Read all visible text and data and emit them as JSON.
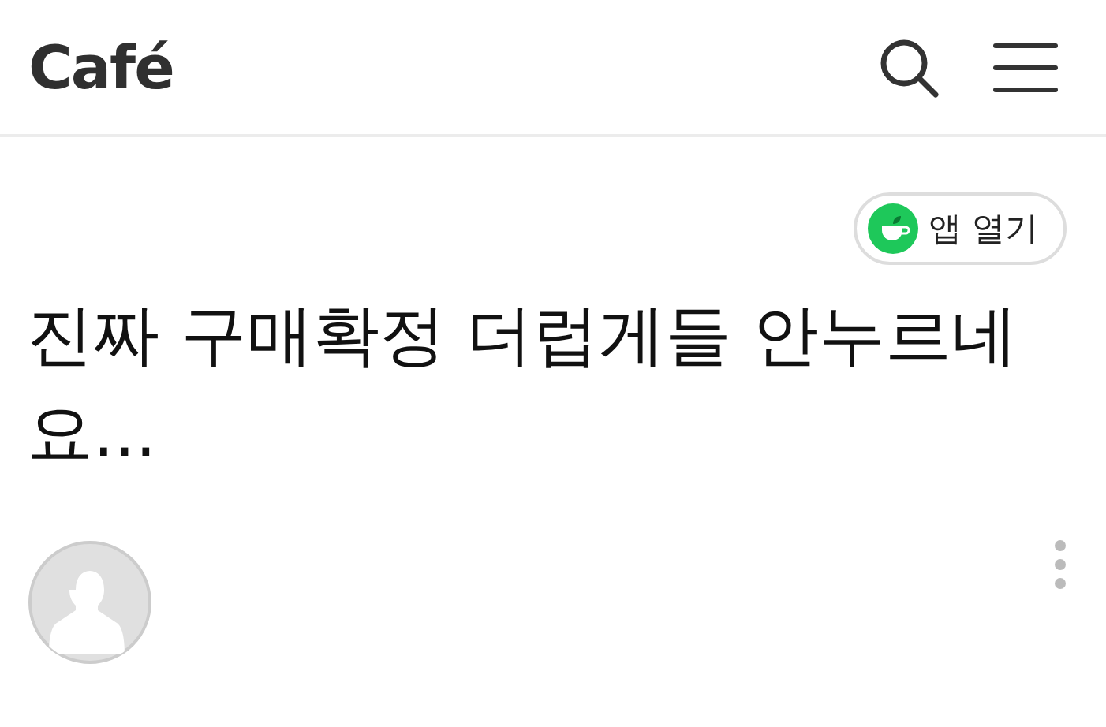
{
  "header": {
    "logo": "Café"
  },
  "open_app_button": {
    "label": "앱 열기"
  },
  "post": {
    "title": "진짜 구매확정 더럽게들 안누르네요..."
  }
}
